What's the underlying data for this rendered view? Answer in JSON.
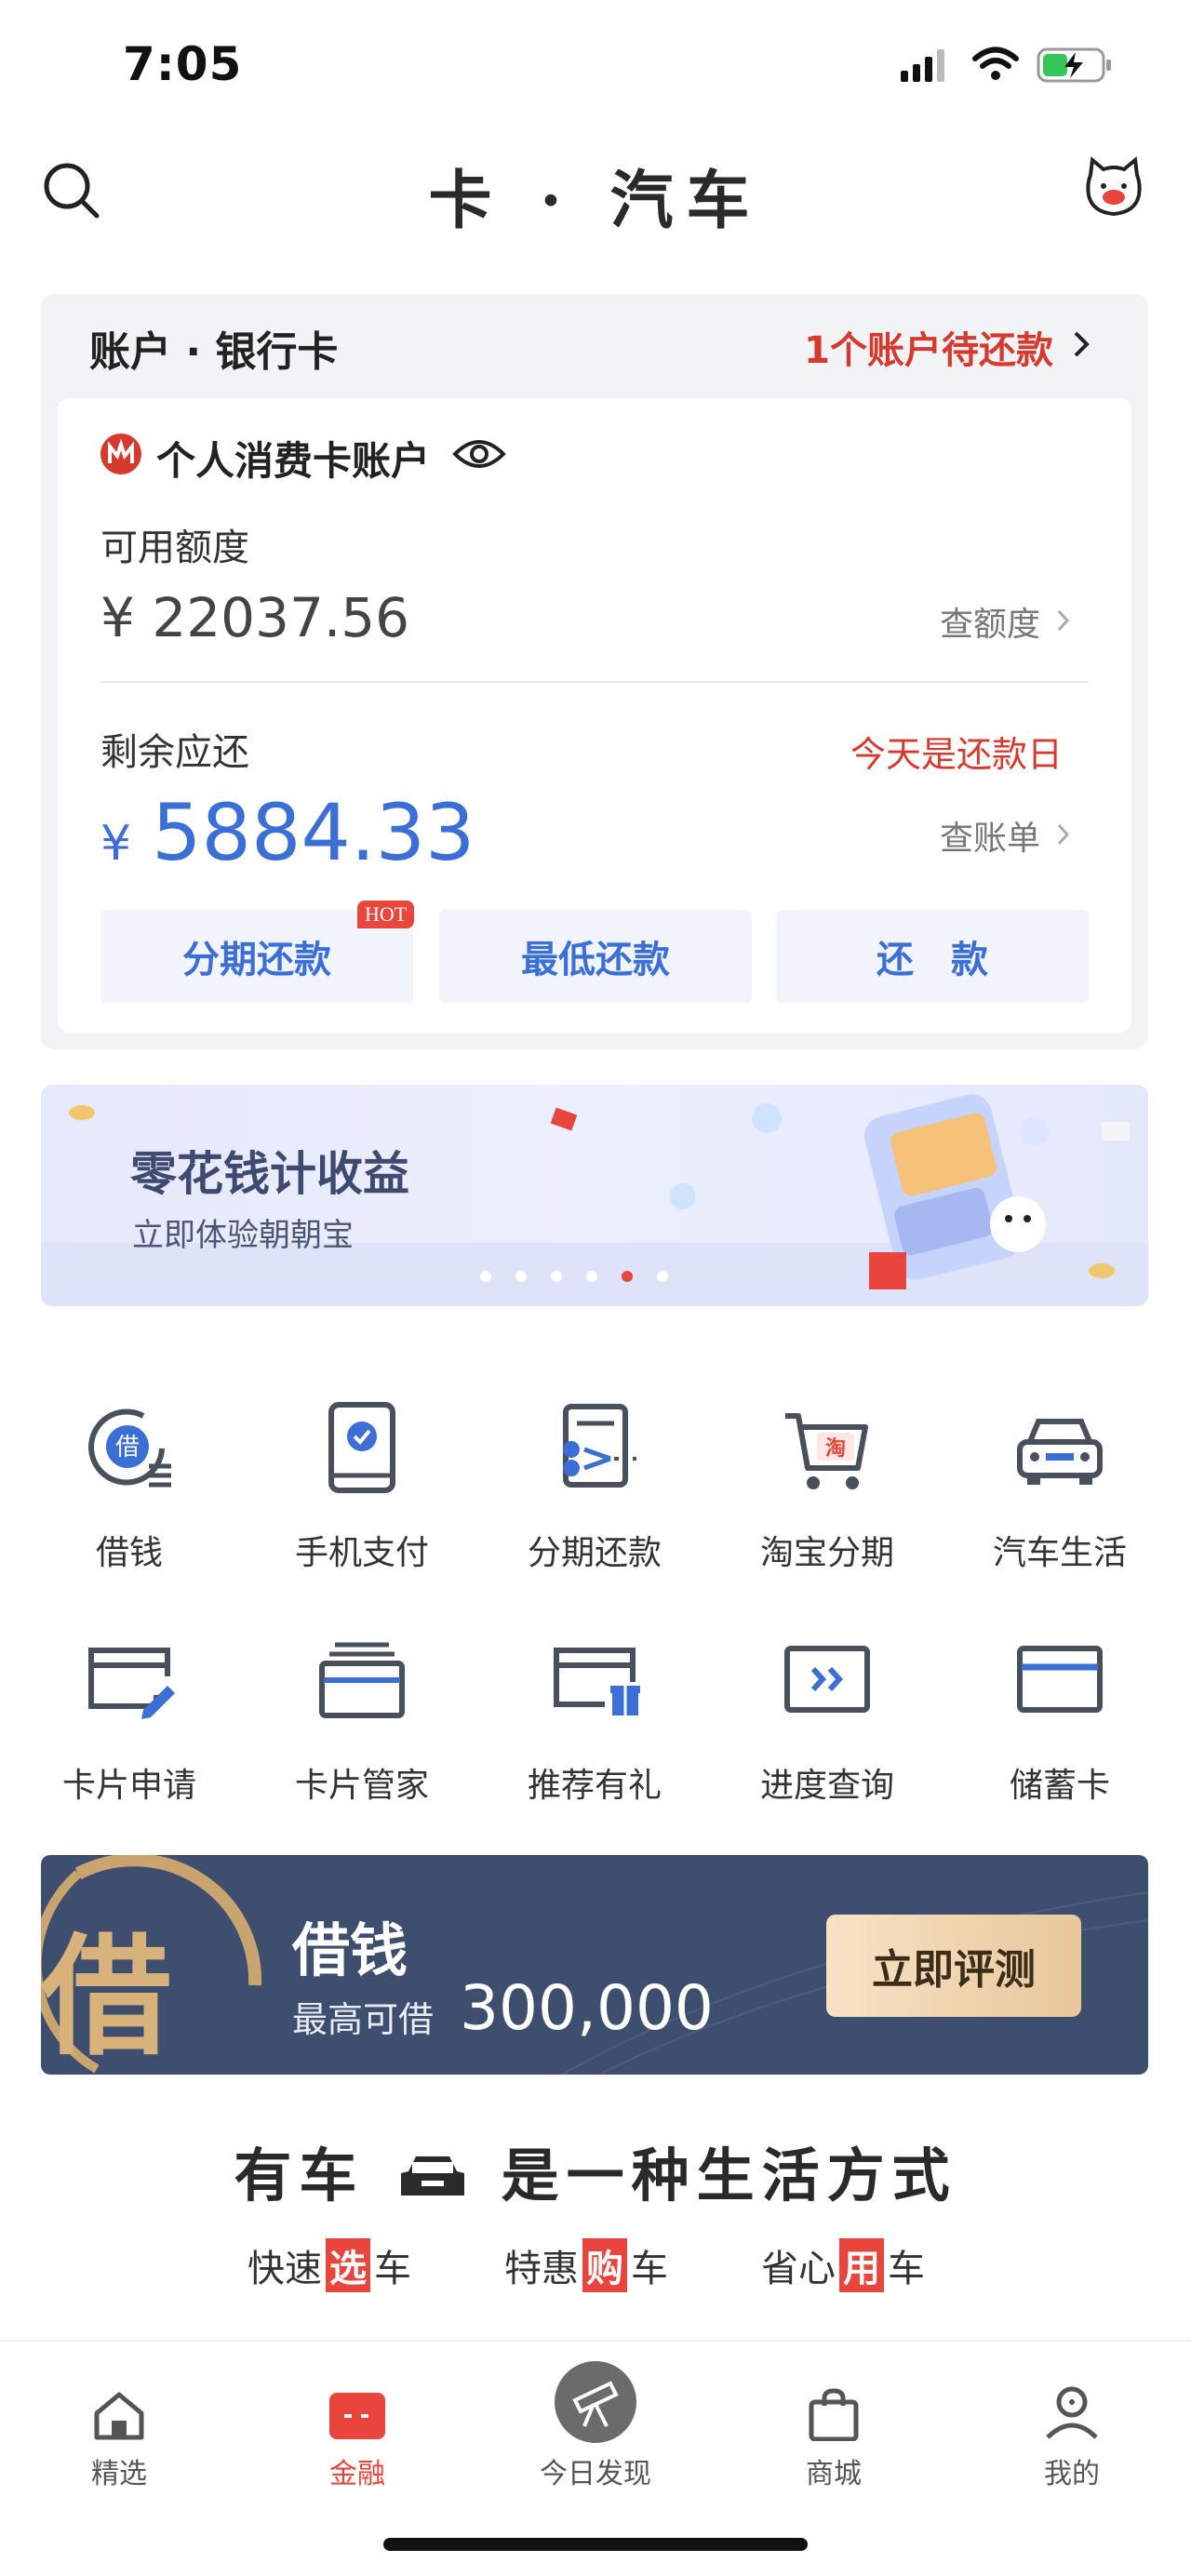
{
  "status_bar": {
    "time": "7:05"
  },
  "header": {
    "title": "卡 · 汽车"
  },
  "account": {
    "section_title": "账户 · 银行卡",
    "due_notice": "1个账户待还款",
    "card_name": "个人消费卡账户",
    "available_label": "可用额度",
    "available_amount": "¥ 22037.56",
    "check_limit": "查额度",
    "remaining_label": "剩余应还",
    "due_today": "今天是还款日",
    "currency": "¥",
    "remaining_amount": "5884.33",
    "check_bill": "查账单",
    "buttons": [
      "分期还款",
      "最低还款",
      "还　款"
    ],
    "hot_badge": "HOT"
  },
  "banner": {
    "title": "零花钱计收益",
    "subtitle": "立即体验朝朝宝",
    "dots": 6,
    "active_dot": 4
  },
  "grid": [
    {
      "label": "借钱",
      "icon": "borrow-icon"
    },
    {
      "label": "手机支付",
      "icon": "phone-pay-icon"
    },
    {
      "label": "分期还款",
      "icon": "installment-icon"
    },
    {
      "label": "淘宝分期",
      "icon": "taobao-cart-icon"
    },
    {
      "label": "汽车生活",
      "icon": "car-icon"
    },
    {
      "label": "卡片申请",
      "icon": "card-apply-icon"
    },
    {
      "label": "卡片管家",
      "icon": "card-manager-icon"
    },
    {
      "label": "推荐有礼",
      "icon": "referral-gift-icon"
    },
    {
      "label": "进度查询",
      "icon": "progress-icon"
    },
    {
      "label": "储蓄卡",
      "icon": "debit-card-icon"
    }
  ],
  "loan_banner": {
    "seal": "借",
    "title": "借钱",
    "prefix": "最高可借",
    "amount": "300,000",
    "cta": "立即评测"
  },
  "car": {
    "slogan_a": "有车",
    "slogan_b": "是一种生活方式",
    "links": [
      {
        "pre": "快速",
        "hl": "选",
        "post": "车"
      },
      {
        "pre": "特惠",
        "hl": "购",
        "post": "车"
      },
      {
        "pre": "省心",
        "hl": "用",
        "post": "车"
      }
    ]
  },
  "tabbar": {
    "tabs": [
      {
        "label": "精选",
        "icon": "home-icon"
      },
      {
        "label": "金融",
        "icon": "wallet-icon"
      },
      {
        "label": "今日发现",
        "icon": "telescope-icon"
      },
      {
        "label": "商城",
        "icon": "shopping-bag-icon"
      },
      {
        "label": "我的",
        "icon": "user-icon"
      }
    ],
    "active": 1
  },
  "colors": {
    "accent_red": "#d63a2f",
    "accent_blue": "#3b6fd6",
    "loan_bg": "#3e4e6e"
  }
}
